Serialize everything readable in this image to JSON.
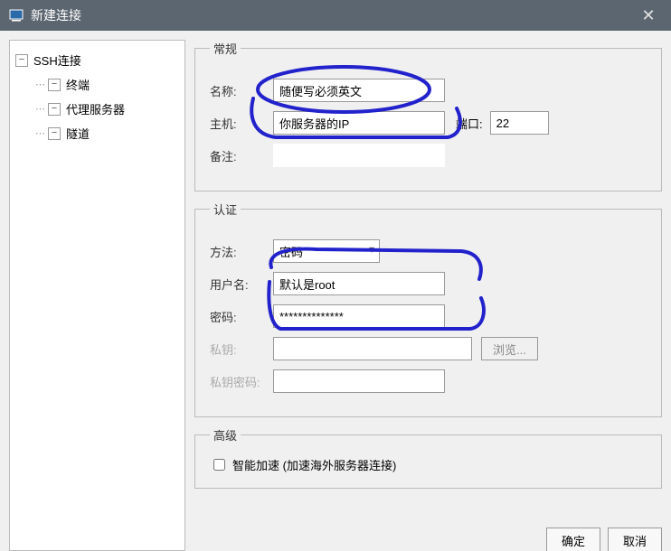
{
  "titlebar": {
    "title": "新建连接",
    "close": "✕"
  },
  "sidebar": {
    "root": "SSH连接",
    "items": [
      "终端",
      "代理服务器",
      "隧道"
    ]
  },
  "general": {
    "legend": "常规",
    "name_label": "名称:",
    "name_value": "随便写必须英文",
    "host_label": "主机:",
    "host_value": "你服务器的IP",
    "port_label": "端口:",
    "port_value": "22",
    "remarks_label": "备注:"
  },
  "auth": {
    "legend": "认证",
    "method_label": "方法:",
    "method_value": "密码",
    "username_label": "用户名:",
    "username_value": "默认是root",
    "password_label": "密码:",
    "password_value": "**************",
    "privkey_label": "私钥:",
    "privkey_pass_label": "私钥密码:",
    "browse_label": "浏览..."
  },
  "advanced": {
    "legend": "高级",
    "smart_accel": "智能加速 (加速海外服务器连接)"
  },
  "buttons": {
    "ok": "确定",
    "cancel": "取消"
  }
}
